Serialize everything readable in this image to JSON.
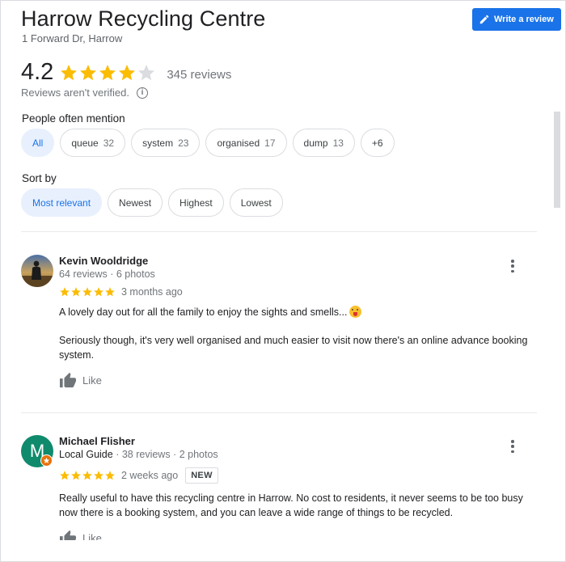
{
  "header": {
    "title": "Harrow Recycling Centre",
    "address": "1 Forward Dr, Harrow",
    "write_review_label": "Write a review"
  },
  "summary": {
    "rating": "4.2",
    "stars_filled": 4,
    "stars_total": 5,
    "review_count": "345 reviews",
    "unverified_note": "Reviews aren't verified."
  },
  "mentions": {
    "label": "People often mention",
    "chips": [
      {
        "label": "All",
        "count": ""
      },
      {
        "label": "queue",
        "count": "32"
      },
      {
        "label": "system",
        "count": "23"
      },
      {
        "label": "organised",
        "count": "17"
      },
      {
        "label": "dump",
        "count": "13"
      },
      {
        "label": "+6",
        "count": ""
      }
    ]
  },
  "sort": {
    "label": "Sort by",
    "options": [
      "Most relevant",
      "Newest",
      "Highest",
      "Lowest"
    ]
  },
  "reviews": [
    {
      "name": "Kevin Wooldridge",
      "meta": "64 reviews · 6 photos",
      "stars": 5,
      "time": "3 months ago",
      "paragraph1": "A lovely day out for all the family to enjoy the sights and smells...",
      "paragraph2": "Seriously though, it's very well organised and much easier to visit now there's an online advance booking system.",
      "like_label": "Like"
    },
    {
      "name": "Michael Flisher",
      "avatar_letter": "M",
      "guide_label": "Local Guide",
      "meta": "· 38 reviews · 2 photos",
      "stars": 5,
      "time": "2 weeks ago",
      "badge": "NEW",
      "paragraph1": "Really useful to have this recycling centre in Harrow. No cost to residents, it never seems to be too busy now there is a booking system, and you can leave a wide range of things to be recycled.",
      "like_label": "Like"
    }
  ],
  "colors": {
    "star": "#fbbc04",
    "star_empty": "#dadce0",
    "accent": "#1a73e8",
    "avatar_green": "#0f8a6c",
    "guide_orange": "#e8710a"
  }
}
